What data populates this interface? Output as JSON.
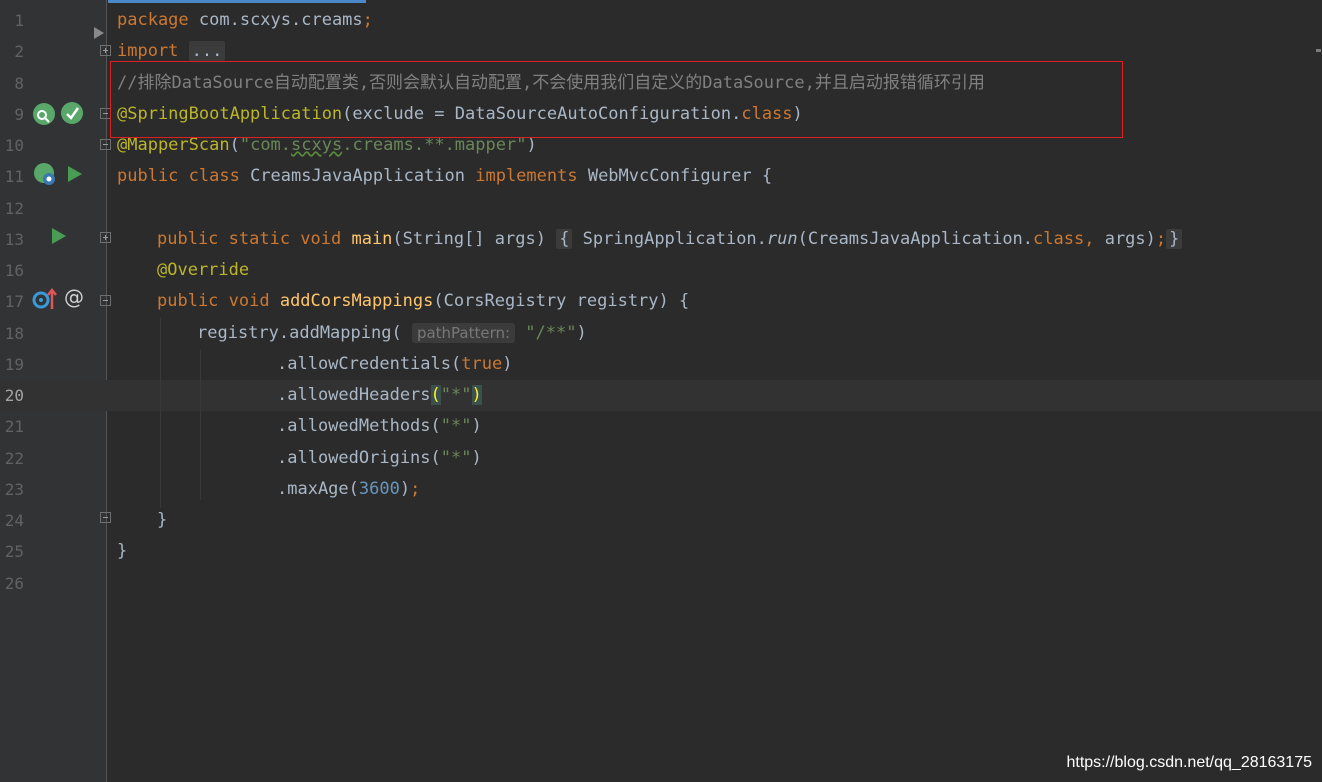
{
  "editor": {
    "lines": [
      {
        "num": "1",
        "segments": [
          [
            "kw",
            "package "
          ],
          [
            "",
            "com.scxys.creams"
          ],
          [
            "kw",
            ";"
          ]
        ]
      },
      {
        "num": "2",
        "segments": [
          [
            "kw",
            "import "
          ],
          [
            "fold",
            "..."
          ]
        ]
      },
      {
        "num": "8",
        "segments": [
          [
            "cm",
            "//排除DataSource自动配置类,否则会默认自动配置,不会使用我们自定义的DataSource,并且启动报错循环引用"
          ]
        ]
      },
      {
        "num": "9",
        "segments": [
          [
            "an",
            "@SpringBootApplication"
          ],
          [
            "",
            "(exclude = DataSourceAutoConfiguration."
          ],
          [
            "kw",
            "class"
          ],
          [
            "",
            ")"
          ]
        ]
      },
      {
        "num": "10",
        "segments": [
          [
            "an",
            "@MapperScan"
          ],
          [
            "",
            "("
          ],
          [
            "str",
            "\"com."
          ],
          [
            "strsq",
            "scxys"
          ],
          [
            "str",
            ".creams.**.mapper\""
          ],
          [
            "",
            ")"
          ]
        ]
      },
      {
        "num": "11",
        "segments": [
          [
            "kw",
            "public class "
          ],
          [
            "",
            "CreamsJavaApplication "
          ],
          [
            "kw",
            "implements "
          ],
          [
            "",
            "WebMvcConfigurer {"
          ]
        ]
      },
      {
        "num": "12",
        "segments": []
      },
      {
        "num": "13",
        "segments": [
          [
            "kw",
            "public static void "
          ],
          [
            "fn",
            "main"
          ],
          [
            "",
            "(String[] args) "
          ],
          [
            "fold",
            "{"
          ],
          [
            "",
            " SpringApplication."
          ],
          [
            "it",
            "run"
          ],
          [
            "",
            "(CreamsJavaApplication."
          ],
          [
            "kw",
            "class"
          ],
          [
            "kw",
            ", "
          ],
          [
            "",
            "args)"
          ],
          [
            "kw",
            ";"
          ],
          [
            "fold",
            "}"
          ]
        ]
      },
      {
        "num": "16",
        "segments": [
          [
            "an",
            "@Override"
          ]
        ]
      },
      {
        "num": "17",
        "segments": [
          [
            "kw",
            "public void "
          ],
          [
            "fn",
            "addCorsMappings"
          ],
          [
            "",
            "(CorsRegistry registry) {"
          ]
        ]
      },
      {
        "num": "18",
        "segments": [
          [
            "",
            "registry.addMapping( "
          ],
          [
            "hint",
            "pathPattern:"
          ],
          [
            "str",
            " \"/**\""
          ],
          [
            "",
            ")"
          ]
        ]
      },
      {
        "num": "19",
        "segments": [
          [
            "",
            ".allowCredentials("
          ],
          [
            "kw",
            "true"
          ],
          [
            "",
            ")"
          ]
        ]
      },
      {
        "num": "20",
        "segments": [
          [
            "",
            ".allowedHeaders"
          ],
          [
            "brace",
            "("
          ],
          [
            "str",
            "\"*\""
          ],
          [
            "brace",
            ")"
          ]
        ]
      },
      {
        "num": "21",
        "segments": [
          [
            "",
            ".allowedMethods("
          ],
          [
            "str",
            "\"*\""
          ],
          [
            "",
            ")"
          ]
        ]
      },
      {
        "num": "22",
        "segments": [
          [
            "",
            ".allowedOrigins("
          ],
          [
            "str",
            "\"*\""
          ],
          [
            "",
            ")"
          ]
        ]
      },
      {
        "num": "23",
        "segments": [
          [
            "",
            ".maxAge("
          ],
          [
            "num",
            "3600"
          ],
          [
            "",
            ")"
          ],
          [
            "kw",
            ";"
          ]
        ]
      },
      {
        "num": "24",
        "segments": [
          [
            "",
            "}"
          ]
        ]
      },
      {
        "num": "25",
        "segments": [
          [
            "",
            "}"
          ]
        ]
      },
      {
        "num": "26",
        "segments": []
      }
    ],
    "current_line": "20"
  },
  "watermark": "https://blog.csdn.net/qq_28163175",
  "colors": {
    "keyword": "#cc7832",
    "annotation": "#bbb529",
    "string": "#6a8759",
    "comment": "#808080",
    "number": "#6897bb",
    "function": "#ffc66d",
    "highlight_box": "#e02020"
  },
  "gutter_icons": [
    {
      "line": "9",
      "icons": [
        "bean-search-icon",
        "bean-check-icon"
      ]
    },
    {
      "line": "11",
      "icons": [
        "spring-bean-icon",
        "run-icon"
      ]
    },
    {
      "line": "13",
      "icons": [
        "run-icon"
      ]
    },
    {
      "line": "17",
      "icons": [
        "implements-method-icon",
        "at-annotation-icon"
      ]
    }
  ]
}
